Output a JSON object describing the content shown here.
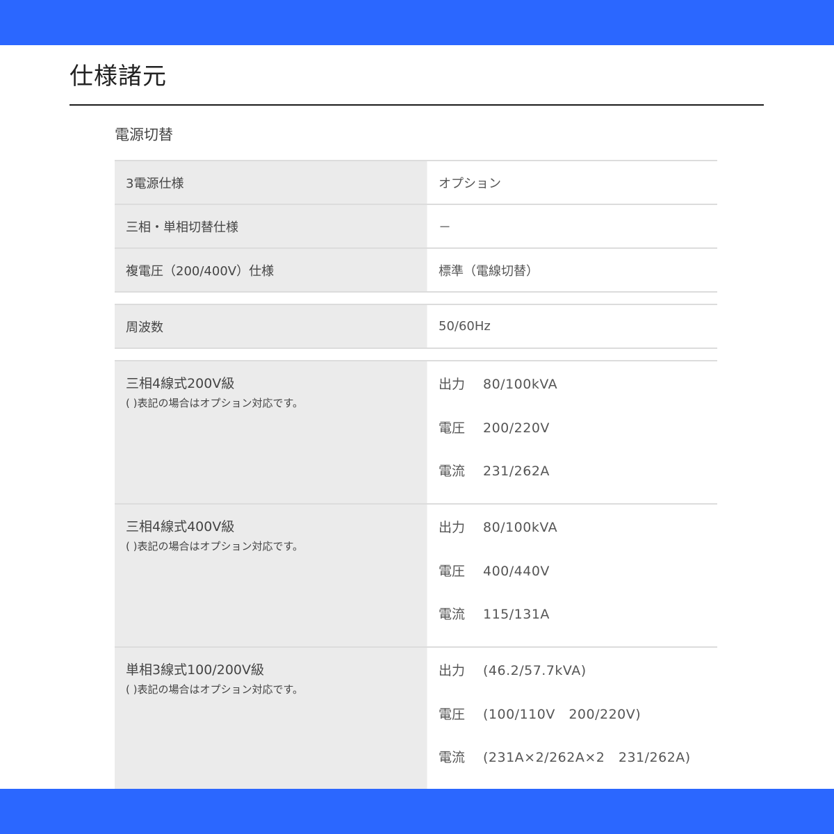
{
  "header": {
    "title": "仕様諸元"
  },
  "section": {
    "heading": "電源切替"
  },
  "switching_rows": [
    {
      "label": "3電源仕様",
      "value": "オプション"
    },
    {
      "label": "三相・単相切替仕様",
      "value": "－"
    },
    {
      "label": "複電圧（200/400V）仕様",
      "value": "標準（電線切替）"
    }
  ],
  "frequency": {
    "label": "周波数",
    "value": "50/60Hz"
  },
  "output_groups": [
    {
      "title": "三相4線式200V級",
      "note": "( )表記の場合はオプション対応です。",
      "lines": [
        {
          "label": "出力",
          "value": "80/100kVA"
        },
        {
          "label": "電圧",
          "value": "200/220V"
        },
        {
          "label": "電流",
          "value": "231/262A"
        }
      ]
    },
    {
      "title": "三相4線式400V級",
      "note": "( )表記の場合はオプション対応です。",
      "lines": [
        {
          "label": "出力",
          "value": "80/100kVA"
        },
        {
          "label": "電圧",
          "value": "400/440V"
        },
        {
          "label": "電流",
          "value": "115/131A"
        }
      ]
    },
    {
      "title": "単相3線式100/200V級",
      "note": "( )表記の場合はオプション対応です。",
      "lines": [
        {
          "label": "出力",
          "value": "(46.2/57.7kVA)"
        },
        {
          "label": "電圧",
          "value": "(100/110V　200/220V)"
        },
        {
          "label": "電流",
          "value": "(231A×2/262A×2　231/262A)"
        }
      ]
    }
  ],
  "colors": {
    "band": "#2b67ff",
    "key_cell_bg": "#ebebeb",
    "border": "#dcdcdc"
  }
}
